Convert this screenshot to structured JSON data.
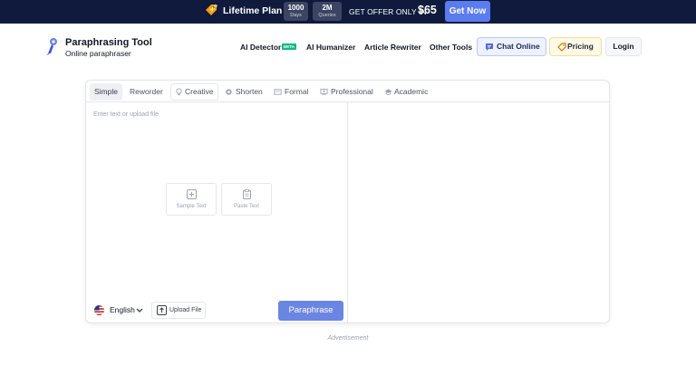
{
  "promo": {
    "title": "Lifetime Plan",
    "days_value": "1000",
    "days_label": "Days",
    "queries_value": "2M",
    "queries_label": "Queries",
    "offer_text": "GET OFFER ONLY IN",
    "price": "$65",
    "cta": "Get Now"
  },
  "header": {
    "brand": "Paraphrasing Tool",
    "tagline": "Online paraphraser",
    "nav": [
      {
        "label": "AI Detector",
        "badge": "BETA"
      },
      {
        "label": "AI Humanizer"
      },
      {
        "label": "Article Rewriter"
      },
      {
        "label": "Other Tools"
      }
    ],
    "chat_label": "Chat Online",
    "pricing_label": "Pricing",
    "login_label": "Login"
  },
  "editor": {
    "tabs": [
      {
        "label": "Simple",
        "icon": ""
      },
      {
        "label": "Reworder",
        "icon": ""
      },
      {
        "label": "Creative",
        "icon": "bulb-icon"
      },
      {
        "label": "Shorten",
        "icon": "gear-icon"
      },
      {
        "label": "Formal",
        "icon": "list-icon"
      },
      {
        "label": "Professional",
        "icon": "presentation-icon"
      },
      {
        "label": "Academic",
        "icon": "graduation-cap-icon"
      }
    ],
    "active_tab": "Simple",
    "input_placeholder": "Enter text or upload file",
    "sample_text_label": "Sample Text",
    "paste_text_label": "Paste Text",
    "language": "English",
    "upload_label": "Upload File",
    "paraphrase_label": "Paraphrase"
  },
  "advertisement_label": "Advertisement",
  "colors": {
    "banner_bg": "#0f1a3d",
    "cta_blue": "#5a7cf0",
    "paraphrase_button": "#6b85e3",
    "beta_badge": "#10b981"
  }
}
